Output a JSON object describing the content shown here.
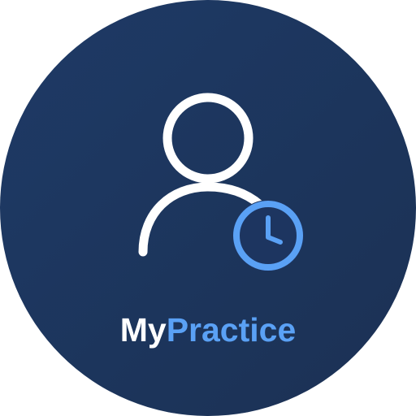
{
  "logo": {
    "wordmark_part1": "My",
    "wordmark_part2": "Practice",
    "icon": "user-clock-icon"
  },
  "colors": {
    "background_start": "#1d3560",
    "background_end": "#1c3457",
    "user_outline": "#ffffff",
    "accent": "#5aa1f5",
    "text_primary": "#ffffff"
  }
}
